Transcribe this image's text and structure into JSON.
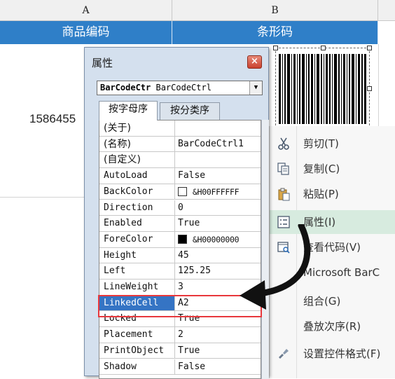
{
  "sheet": {
    "col_a": "A",
    "col_b": "B",
    "header_a": "商品编码",
    "header_b": "条形码",
    "cell_a2": "1586455"
  },
  "props": {
    "title": "属性",
    "close_label": "×",
    "object_bold": "BarCodeCtr",
    "object_type": " BarCodeCtrl",
    "tab_alpha": "按字母序",
    "tab_category": "按分类序",
    "rows": [
      {
        "name": "(关于)",
        "value": ""
      },
      {
        "name": "(名称)",
        "value": "BarCodeCtrl1"
      },
      {
        "name": "(自定义)",
        "value": ""
      },
      {
        "name": "AutoLoad",
        "value": "False"
      },
      {
        "name": "BackColor",
        "value": "&H00FFFFFF"
      },
      {
        "name": "Direction",
        "value": "0"
      },
      {
        "name": "Enabled",
        "value": "True"
      },
      {
        "name": "ForeColor",
        "value": "&H00000000"
      },
      {
        "name": "Height",
        "value": "45"
      },
      {
        "name": "Left",
        "value": "125.25"
      },
      {
        "name": "LineWeight",
        "value": "3"
      },
      {
        "name": "LinkedCell",
        "value": "A2"
      },
      {
        "name": "Locked",
        "value": "True"
      },
      {
        "name": "Placement",
        "value": "2"
      },
      {
        "name": "PrintObject",
        "value": "True"
      },
      {
        "name": "Shadow",
        "value": "False"
      }
    ]
  },
  "menu": {
    "items": [
      {
        "label": "剪切(T)",
        "icon": "scissors-icon"
      },
      {
        "label": "复制(C)",
        "icon": "copy-icon"
      },
      {
        "label": "粘贴(P)",
        "icon": "paste-icon"
      },
      {
        "label": "属性(I)",
        "icon": "properties-icon"
      },
      {
        "label": "查看代码(V)",
        "icon": "view-code-icon"
      },
      {
        "label": "Microsoft BarC",
        "icon": ""
      },
      {
        "label": "组合(G)",
        "icon": ""
      },
      {
        "label": "叠放次序(R)",
        "icon": ""
      },
      {
        "label": "设置控件格式(F)",
        "icon": "format-control-icon"
      }
    ]
  },
  "colors": {
    "header_blue": "#2f7fc8",
    "selection_blue": "#3574c4",
    "highlight_red": "#e8383c",
    "menu_highlight": "#d7ebdf"
  }
}
